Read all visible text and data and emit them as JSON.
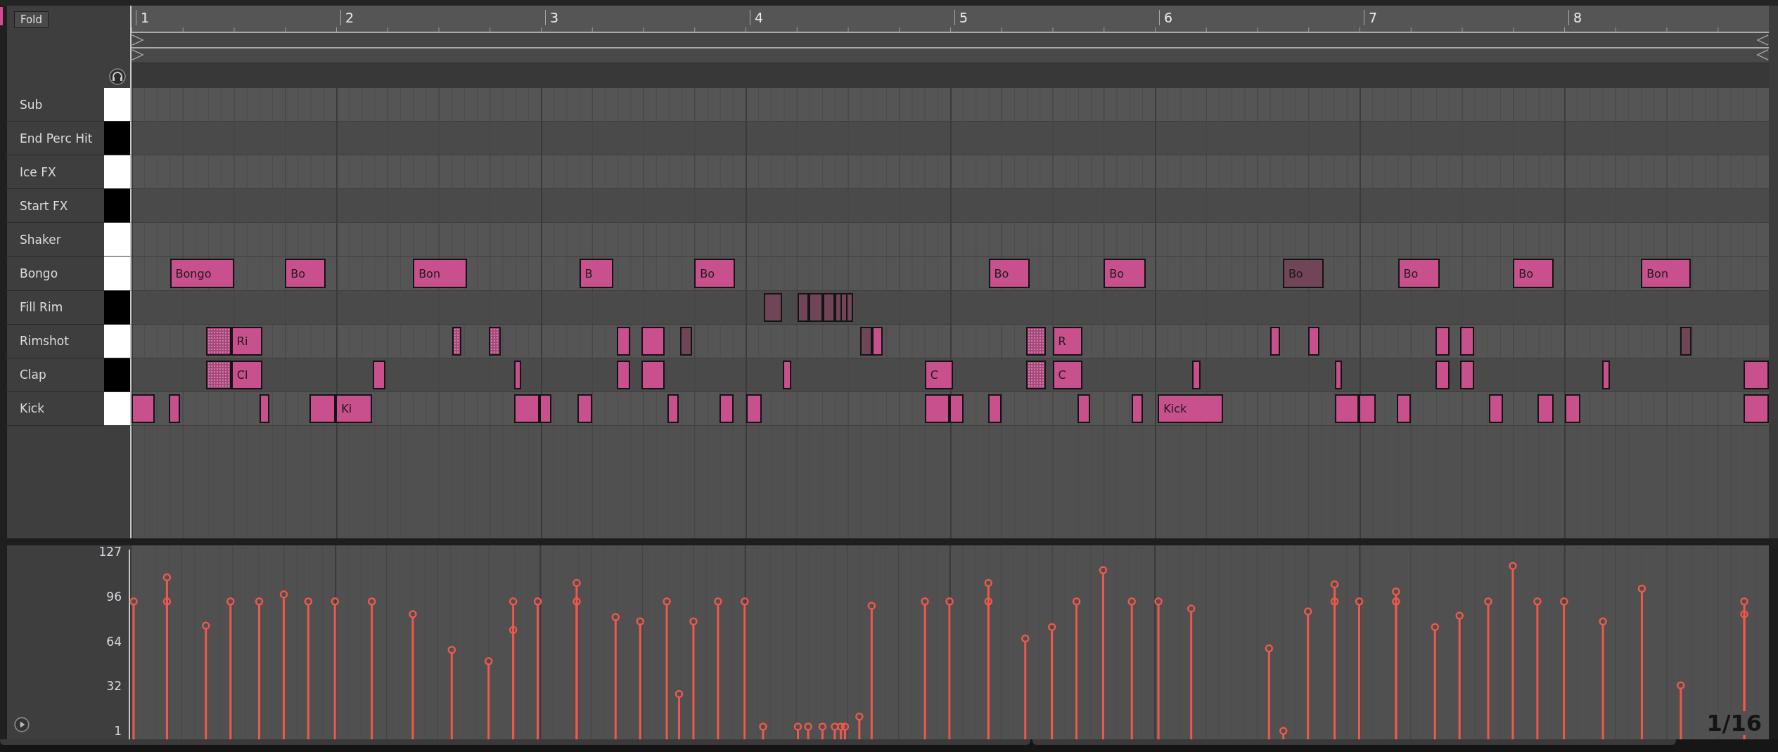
{
  "header": {
    "fold_button": "Fold"
  },
  "ruler": {
    "bars": [
      "1",
      "2",
      "3",
      "4",
      "5",
      "6",
      "7",
      "8"
    ]
  },
  "rows": [
    {
      "name": "Sub",
      "kind": "white_key",
      "notes": []
    },
    {
      "name": "End Perc Hit",
      "kind": "black_key",
      "notes": []
    },
    {
      "name": "Ice FX",
      "kind": "white_key",
      "notes": []
    },
    {
      "name": "Start FX",
      "kind": "black_key",
      "notes": []
    },
    {
      "name": "Shaker",
      "kind": "white_key",
      "notes": []
    },
    {
      "name": "Bongo",
      "kind": "white_key",
      "notes": [
        {
          "label": "Bongo",
          "muted": false,
          "faded": false
        },
        {
          "label": "Bo",
          "muted": false,
          "faded": false
        },
        {
          "label": "Bon",
          "muted": false,
          "faded": false
        },
        {
          "label": "B",
          "muted": false,
          "faded": false
        },
        {
          "label": "Bo",
          "muted": false,
          "faded": false
        },
        {
          "label": "Bo",
          "muted": false,
          "faded": false
        },
        {
          "label": "Bo",
          "muted": false,
          "faded": false
        },
        {
          "label": "Bo",
          "muted": true,
          "faded": false
        },
        {
          "label": "Bo",
          "muted": false,
          "faded": false
        },
        {
          "label": "Bo",
          "muted": false,
          "faded": false
        },
        {
          "label": "Bon",
          "muted": false,
          "faded": false
        }
      ]
    },
    {
      "name": "Fill Rim",
      "kind": "black_key",
      "notes": [
        {
          "muted": true,
          "faded": false
        },
        {
          "muted": true,
          "faded": false
        },
        {
          "muted": true,
          "faded": false
        },
        {
          "muted": true,
          "faded": false
        },
        {
          "muted": true,
          "faded": false
        },
        {
          "muted": true,
          "faded": false
        },
        {
          "muted": true,
          "faded": false
        }
      ]
    },
    {
      "name": "Rimshot",
      "kind": "white_key",
      "notes": [
        {
          "muted": false,
          "faded": true
        },
        {
          "label": "Ri",
          "muted": false,
          "faded": false
        },
        {
          "muted": false,
          "faded": true
        },
        {
          "muted": false,
          "faded": true
        },
        {
          "muted": false,
          "faded": false
        },
        {
          "muted": false,
          "faded": false
        },
        {
          "muted": true,
          "faded": false
        },
        {
          "muted": true,
          "faded": false
        },
        {
          "muted": false,
          "faded": false
        },
        {
          "muted": false,
          "faded": true
        },
        {
          "label": "R",
          "muted": false,
          "faded": false
        },
        {
          "muted": false,
          "faded": false
        },
        {
          "muted": false,
          "faded": false
        },
        {
          "muted": false,
          "faded": false
        },
        {
          "muted": false,
          "faded": false
        },
        {
          "muted": true,
          "faded": false
        }
      ]
    },
    {
      "name": "Clap",
      "kind": "black_key",
      "notes": [
        {
          "muted": false,
          "faded": true
        },
        {
          "label": "Cl",
          "muted": false,
          "faded": false
        },
        {
          "muted": false,
          "faded": false
        },
        {
          "muted": false,
          "faded": false
        },
        {
          "muted": false,
          "faded": false
        },
        {
          "muted": false,
          "faded": false
        },
        {
          "muted": false,
          "faded": false
        },
        {
          "label": "C",
          "muted": false,
          "faded": false
        },
        {
          "muted": false,
          "faded": true
        },
        {
          "label": "C",
          "muted": false,
          "faded": false
        },
        {
          "muted": false,
          "faded": false
        },
        {
          "muted": false,
          "faded": false
        },
        {
          "muted": false,
          "faded": false
        },
        {
          "muted": false,
          "faded": false
        },
        {
          "muted": false,
          "faded": false
        },
        {
          "muted": false,
          "faded": false
        }
      ]
    },
    {
      "name": "Kick",
      "kind": "white_key",
      "notes": [
        {
          "muted": false,
          "faded": false
        },
        {
          "muted": false,
          "faded": false
        },
        {
          "muted": false,
          "faded": false
        },
        {
          "muted": false,
          "faded": false
        },
        {
          "label": "Ki",
          "muted": false,
          "faded": false
        },
        {
          "muted": false,
          "faded": false
        },
        {
          "muted": false,
          "faded": false
        },
        {
          "muted": false,
          "faded": false
        },
        {
          "muted": false,
          "faded": false
        },
        {
          "muted": false,
          "faded": false
        },
        {
          "muted": false,
          "faded": false
        },
        {
          "muted": false,
          "faded": false
        },
        {
          "muted": false,
          "faded": false
        },
        {
          "muted": false,
          "faded": false
        },
        {
          "muted": false,
          "faded": false
        },
        {
          "muted": false,
          "faded": false
        },
        {
          "label": "Kick",
          "muted": false,
          "faded": false
        },
        {
          "muted": false,
          "faded": false
        },
        {
          "muted": false,
          "faded": false
        },
        {
          "muted": false,
          "faded": false
        },
        {
          "muted": false,
          "faded": false
        },
        {
          "muted": false,
          "faded": false
        },
        {
          "muted": false,
          "faded": false
        },
        {
          "muted": false,
          "faded": false
        }
      ]
    }
  ],
  "velocity": {
    "grid_label": "1/16",
    "axis_labels": [
      "127",
      "96",
      "64",
      "32",
      "1"
    ]
  }
}
